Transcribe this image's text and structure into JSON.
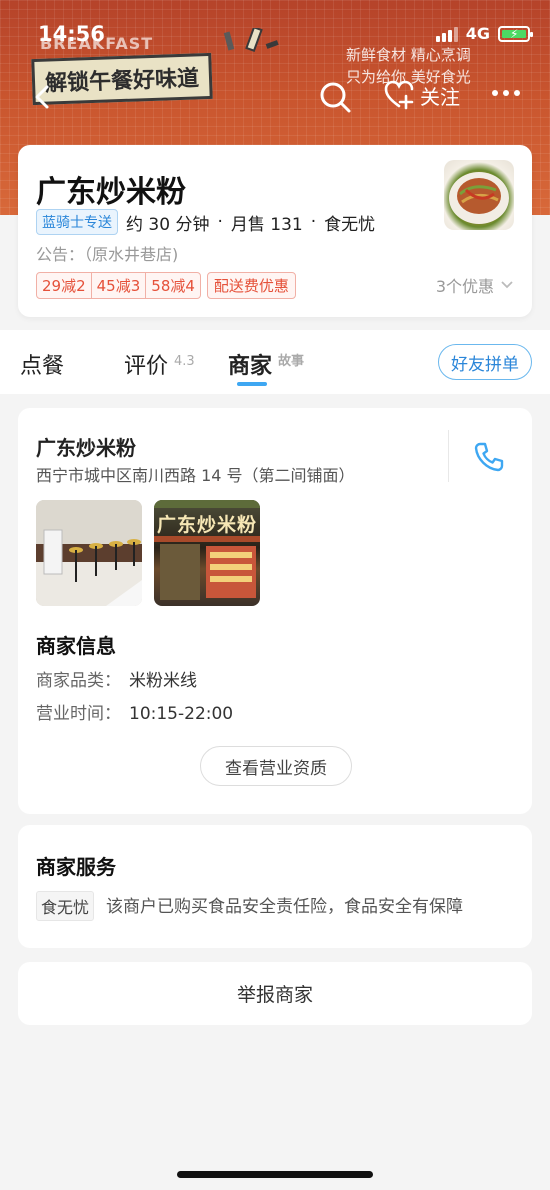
{
  "status_bar": {
    "time": "14:56",
    "network": "4G"
  },
  "banner": {
    "breakfast": "BREAKFAST",
    "promo": "解锁午餐好味道",
    "slogan_line1": "新鲜食材 精心烹调",
    "slogan_line2": "只为给你 美好食光"
  },
  "nav": {
    "follow_label": "关注"
  },
  "shop": {
    "name": "广东炒米粉",
    "delivery_tag": "蓝骑士专送",
    "delivery_time": "约 30 分钟",
    "monthly_sales": "月售 131",
    "food_safety": "食无忧",
    "notice": "公告：（原水井巷店)",
    "coupons": [
      "29减2",
      "45减3",
      "58减4"
    ],
    "delivery_discount": "配送费优惠",
    "offers_count": "3个优惠"
  },
  "tabs": {
    "order": "点餐",
    "reviews": "评价",
    "reviews_score": "4.3",
    "merchant": "商家",
    "story": "故事",
    "friend_order": "好友拼单"
  },
  "merchant": {
    "name": "广东炒米粉",
    "address": "西宁市城中区南川西路 14 号（第二间铺面）",
    "photo_sign": "广东炒米粉",
    "info_title": "商家信息",
    "category_label": "商家品类：",
    "category": "米粉米线",
    "hours_label": "营业时间：",
    "hours": "10:15-22:00",
    "cert_button": "查看营业资质"
  },
  "service": {
    "title": "商家服务",
    "tag": "食无忧",
    "text": "该商户已购买食品安全责任险，食品安全有保障"
  },
  "report_button": "举报商家",
  "colors": {
    "accent_blue": "#3ea7f2",
    "coupon_red": "#e5513a",
    "banner_red": "#c9552e"
  }
}
